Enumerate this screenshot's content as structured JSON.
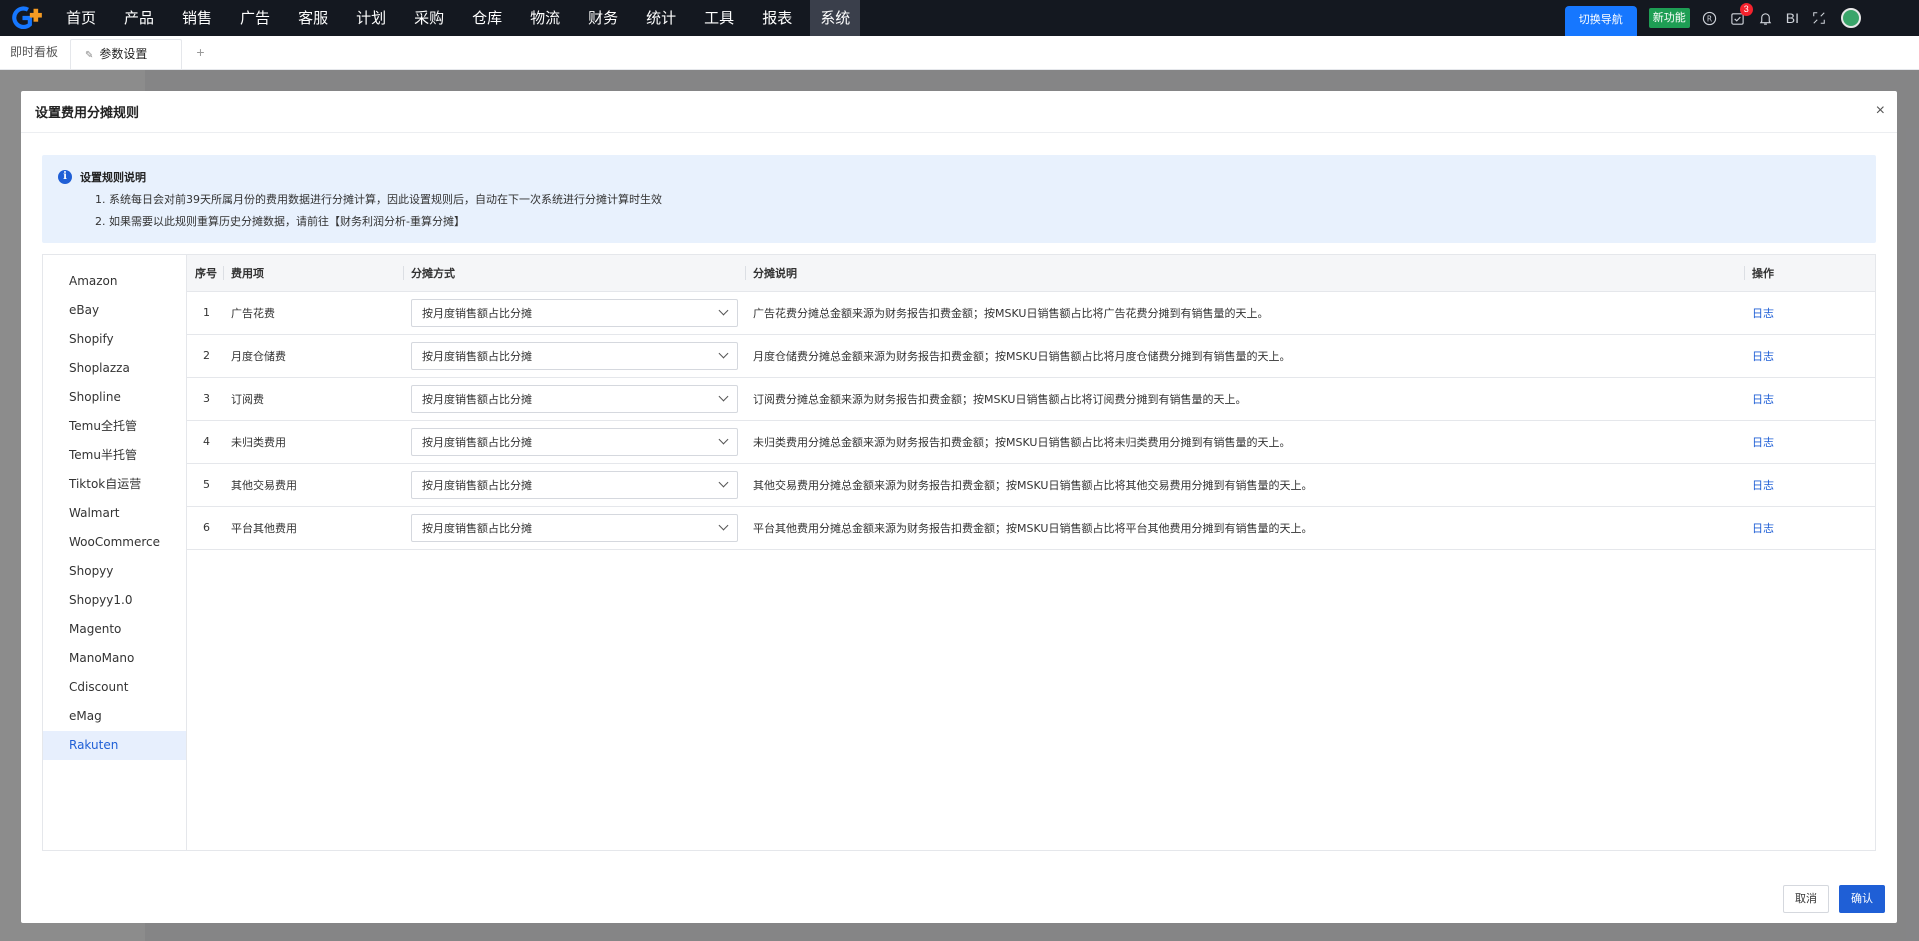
{
  "nav": {
    "items": [
      "首页",
      "产品",
      "销售",
      "广告",
      "客服",
      "计划",
      "采购",
      "仓库",
      "物流",
      "财务",
      "统计",
      "工具",
      "报表",
      "系统"
    ],
    "active": "系统",
    "switch_nav": "切换导航",
    "new_feature": "新功能",
    "notif_count": "3",
    "bi_label": "BI"
  },
  "tabs": {
    "dashboard": "即时看板",
    "current": "参数设置",
    "add": "+"
  },
  "modal": {
    "title": "设置费用分摊规则",
    "close": "×",
    "alert": {
      "title": "设置规则说明",
      "line1": "1. 系统每日会对前39天所属月份的费用数据进行分摊计算，因此设置规则后，自动在下一次系统进行分摊计算时生效",
      "line2": "2. 如果需要以此规则重算历史分摊数据，请前往【财务利润分析-重算分摊】"
    },
    "platforms": [
      "Amazon",
      "eBay",
      "Shopify",
      "Shoplazza",
      "Shopline",
      "Temu全托管",
      "Temu半托管",
      "Tiktok自运营",
      "Walmart",
      "WooCommerce",
      "Shopyy",
      "Shopyy1.0",
      "Magento",
      "ManoMano",
      "Cdiscount",
      "eMag",
      "Rakuten"
    ],
    "active_platform": "Rakuten",
    "table": {
      "headers": {
        "idx": "序号",
        "item": "费用项",
        "method": "分摊方式",
        "desc": "分摊说明",
        "action": "操作"
      },
      "rows": [
        {
          "idx": "1",
          "item": "广告花费",
          "method": "按月度销售额占比分摊",
          "desc": "广告花费分摊总金额来源为财务报告扣费金额；按MSKU日销售额占比将广告花费分摊到有销售量的天上。",
          "action": "日志"
        },
        {
          "idx": "2",
          "item": "月度仓储费",
          "method": "按月度销售额占比分摊",
          "desc": "月度仓储费分摊总金额来源为财务报告扣费金额；按MSKU日销售额占比将月度仓储费分摊到有销售量的天上。",
          "action": "日志"
        },
        {
          "idx": "3",
          "item": "订阅费",
          "method": "按月度销售额占比分摊",
          "desc": "订阅费分摊总金额来源为财务报告扣费金额；按MSKU日销售额占比将订阅费分摊到有销售量的天上。",
          "action": "日志"
        },
        {
          "idx": "4",
          "item": "未归类费用",
          "method": "按月度销售额占比分摊",
          "desc": "未归类费用分摊总金额来源为财务报告扣费金额；按MSKU日销售额占比将未归类费用分摊到有销售量的天上。",
          "action": "日志"
        },
        {
          "idx": "5",
          "item": "其他交易费用",
          "method": "按月度销售额占比分摊",
          "desc": "其他交易费用分摊总金额来源为财务报告扣费金额；按MSKU日销售额占比将其他交易费用分摊到有销售量的天上。",
          "action": "日志"
        },
        {
          "idx": "6",
          "item": "平台其他费用",
          "method": "按月度销售额占比分摊",
          "desc": "平台其他费用分摊总金额来源为财务报告扣费金额；按MSKU日销售额占比将平台其他费用分摊到有销售量的天上。",
          "action": "日志"
        }
      ]
    },
    "footer": {
      "cancel": "取消",
      "ok": "确认"
    }
  },
  "colors": {
    "primary": "#1f5fd6",
    "nav_bg": "#141820",
    "new_feature": "#1e9e54",
    "alert_bg": "#e8f1fd"
  }
}
